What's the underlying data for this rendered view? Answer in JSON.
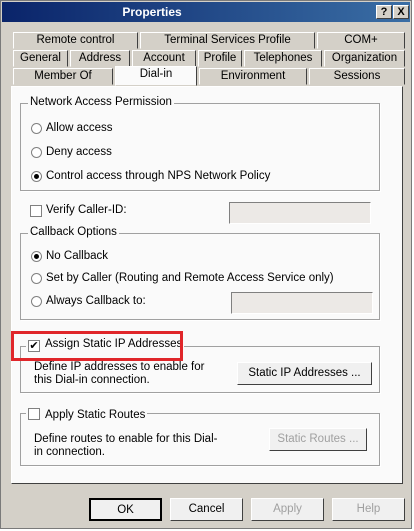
{
  "window": {
    "title": "Properties"
  },
  "title_buttons": {
    "help": "?",
    "close": "X"
  },
  "tabs": {
    "row1": [
      "Remote control",
      "Terminal Services Profile",
      "COM+"
    ],
    "row2": [
      "General",
      "Address",
      "Account",
      "Profile",
      "Telephones",
      "Organization"
    ],
    "row3": [
      "Member Of",
      "Dial-in",
      "Environment",
      "Sessions"
    ],
    "active": "Dial-in"
  },
  "network_access": {
    "legend": "Network Access Permission",
    "options": [
      "Allow access",
      "Deny access",
      "Control access through NPS Network Policy"
    ],
    "selected": "Control access through NPS Network Policy"
  },
  "verify_caller": {
    "label": "Verify Caller-ID:",
    "checked": false,
    "value": ""
  },
  "callback": {
    "legend": "Callback Options",
    "options": [
      "No Callback",
      "Set by Caller (Routing and Remote Access Service only)",
      "Always Callback to:"
    ],
    "selected": "No Callback",
    "always_value": ""
  },
  "static_ip": {
    "label": "Assign Static IP Addresses",
    "checked": true,
    "description": "Define IP addresses to enable for this Dial-in connection.",
    "button": "Static IP Addresses ..."
  },
  "static_routes": {
    "label": "Apply Static Routes",
    "checked": false,
    "description": "Define routes to enable for this Dial-in connection.",
    "button": "Static Routes ..."
  },
  "footer": {
    "ok": "OK",
    "cancel": "Cancel",
    "apply": "Apply",
    "help": "Help"
  },
  "colors": {
    "highlight": "#e0262a",
    "titlebar": "#0a246a"
  }
}
